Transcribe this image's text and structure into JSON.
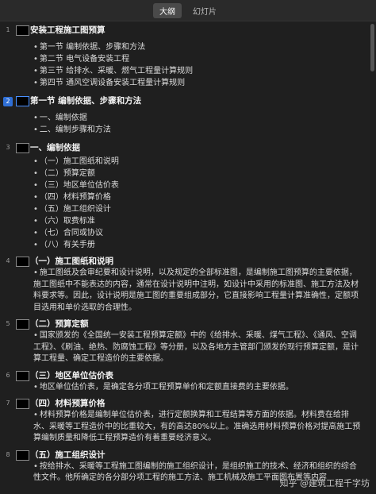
{
  "tabs": {
    "outline": "大纲",
    "slides": "幻灯片"
  },
  "slides": [
    {
      "num": "1",
      "title": "安装工程施工图预算",
      "bullets": [
        "第一节 编制依据、步骤和方法",
        "第二节 电气设备安装工程",
        "第三节 给排水、采暖、燃气工程量计算规则",
        "第四节 通风空调设备安装工程量计算规则"
      ]
    },
    {
      "num": "2",
      "title": "第一节 编制依据、步骤和方法",
      "bullets": [
        "一、编制依据",
        "二、编制步骤和方法"
      ]
    },
    {
      "num": "3",
      "title": "一、编制依据",
      "bullets": [
        "（一）施工图纸和说明",
        "（二）预算定额",
        "（三）地区单位估价表",
        "（四）材料预算价格",
        "（五）施工组织设计",
        "（六）取费标准",
        "（七）合同或协议",
        "（八）有关手册"
      ]
    },
    {
      "num": "4",
      "title": "（一）施工图纸和说明",
      "para": "施工图纸及会审纪要和设计说明，以及规定的全部标准图，是编制施工图预算的主要依据，施工图纸中不能表达的内容，通常在设计说明中注明，如设计中采用的标准图、施工方法及材料要求等。因此，设计说明是施工图的重要组成部分，它直接影响工程量计算准确性，定额项目选用和单价选取的合理性。"
    },
    {
      "num": "5",
      "title": "（二）预算定额",
      "para": "国家颁发的《全国统一安装工程预算定额》中的《给排水、采暖、煤气工程》、《通风、空调工程》、《刷油、绝热、防腐蚀工程》等分册，以及各地方主管部门颁发的现行预算定额，是计算工程量、确定工程造价的主要依据。"
    },
    {
      "num": "6",
      "title": "（三）地区单位估价表",
      "para": "地区单位估价表，是确定各分项工程预算单价和定额直接费的主要依据。"
    },
    {
      "num": "7",
      "title": "（四）材料预算价格",
      "para": "材料预算价格是编制单位估价表，进行定额换算和工程结算等方面的依据。材料费在给排水、采暖等工程造价中的比重较大，有的高达80%以上。准确选用材料预算价格对提高施工预算编制质量和降低工程预算造价有着重要经济意义。"
    },
    {
      "num": "8",
      "title": "（五）施工组织设计",
      "para": "按给排水、采暖等工程施工图编制的施工组织设计，是组织施工的技术、经济和组织的综合性文件。他所确定的各分部分项工程的施工方法、施工机械及施工平面图布置等内容"
    }
  ],
  "watermark": "知乎 @建筑工程千字坊"
}
